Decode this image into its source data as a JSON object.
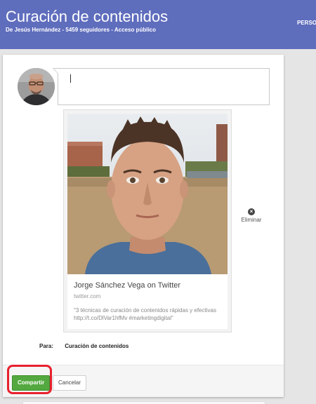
{
  "header": {
    "title": "Curación de contenidos",
    "subtitle": "De Jesús Hernández - 5459 seguidores - Acceso público",
    "persona_label": "PERSO"
  },
  "composer": {
    "value": ""
  },
  "link_card": {
    "title": "Jorge Sánchez Vega on Twitter",
    "domain": "twitter.com",
    "description": "\"3 técnicas de curación de contenidos rápidas y efectivas http://t.co/DlVar1hfMv #marketingdigital\""
  },
  "remove_action": {
    "label": "Eliminar",
    "icon": "close-circle-icon"
  },
  "audience": {
    "label": "Para:",
    "value": "Curación de contenidos"
  },
  "actions": {
    "share_label": "Compartir",
    "cancel_label": "Cancelar"
  },
  "colors": {
    "header_bg": "#5f6dbd",
    "share_button": "#53a93f",
    "highlight": "#e8202e"
  }
}
